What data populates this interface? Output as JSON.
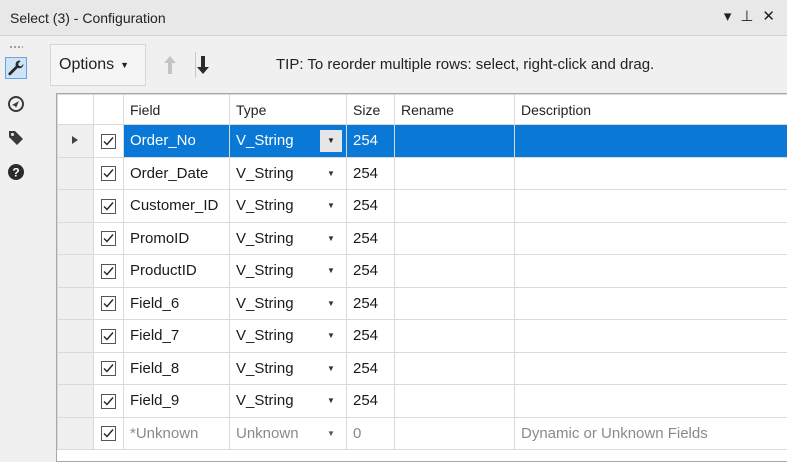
{
  "window": {
    "title": "Select (3) - Configuration",
    "controls": [
      "▾",
      "⊥",
      "✕"
    ]
  },
  "sidebar": {
    "icons": [
      {
        "name": "configuration-wrench-icon",
        "active": true
      },
      {
        "name": "annotation-icon",
        "active": false
      },
      {
        "name": "tag-icon",
        "active": false
      },
      {
        "name": "help-icon",
        "active": false
      }
    ]
  },
  "toolbar": {
    "options_label": "Options",
    "tip": "TIP: To reorder multiple rows: select, right-click and drag."
  },
  "grid": {
    "columns": [
      "Field",
      "Type",
      "Size",
      "Rename",
      "Description"
    ],
    "rows": [
      {
        "checked": true,
        "field": "Order_No",
        "type": "V_String",
        "size": "254",
        "rename": "",
        "description": "",
        "selected": true
      },
      {
        "checked": true,
        "field": "Order_Date",
        "type": "V_String",
        "size": "254",
        "rename": "",
        "description": ""
      },
      {
        "checked": true,
        "field": "Customer_ID",
        "type": "V_String",
        "size": "254",
        "rename": "",
        "description": ""
      },
      {
        "checked": true,
        "field": "PromoID",
        "type": "V_String",
        "size": "254",
        "rename": "",
        "description": ""
      },
      {
        "checked": true,
        "field": "ProductID",
        "type": "V_String",
        "size": "254",
        "rename": "",
        "description": ""
      },
      {
        "checked": true,
        "field": "Field_6",
        "type": "V_String",
        "size": "254",
        "rename": "",
        "description": ""
      },
      {
        "checked": true,
        "field": "Field_7",
        "type": "V_String",
        "size": "254",
        "rename": "",
        "description": ""
      },
      {
        "checked": true,
        "field": "Field_8",
        "type": "V_String",
        "size": "254",
        "rename": "",
        "description": ""
      },
      {
        "checked": true,
        "field": "Field_9",
        "type": "V_String",
        "size": "254",
        "rename": "",
        "description": ""
      },
      {
        "checked": true,
        "field": "*Unknown",
        "type": "Unknown",
        "size": "0",
        "rename": "",
        "description": "Dynamic or Unknown Fields",
        "dim": true
      }
    ]
  },
  "colors": {
    "selection": "#0a78d7",
    "active_icon_bg": "#cfe3f7"
  }
}
